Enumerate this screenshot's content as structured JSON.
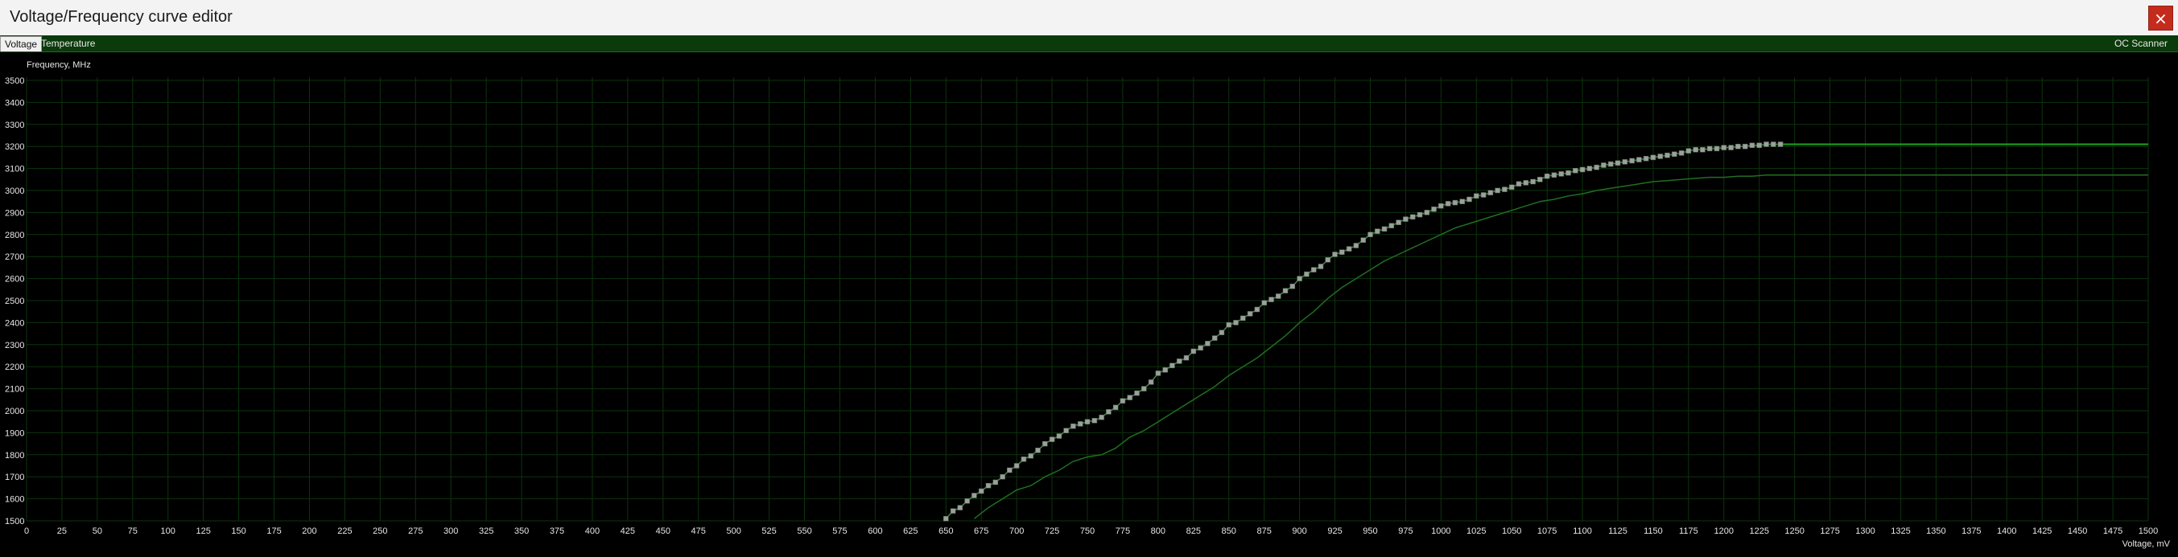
{
  "window": {
    "title": "Voltage/Frequency curve editor",
    "close_symbol": "×"
  },
  "tabs": {
    "voltage": "Voltage",
    "temperature": "Temperature",
    "oc_scanner": "OC Scanner"
  },
  "colors": {
    "grid": "#0c340c",
    "axis_text": "#e6e6e6",
    "curve": "#3c8f3c",
    "point": "#9aa09a",
    "baseline": "#1f6f1f",
    "flat_line": "#1aa31a"
  },
  "chart_data": {
    "type": "line",
    "ylabel": "Frequency, MHz",
    "xlabel": "Voltage, mV",
    "xlim": [
      0,
      1500
    ],
    "ylim": [
      1500,
      3500
    ],
    "x_ticks": [
      0,
      25,
      50,
      75,
      100,
      125,
      150,
      175,
      200,
      225,
      250,
      275,
      300,
      325,
      350,
      375,
      400,
      425,
      450,
      475,
      500,
      525,
      550,
      575,
      600,
      625,
      650,
      675,
      700,
      725,
      750,
      775,
      800,
      825,
      850,
      875,
      900,
      925,
      950,
      975,
      1000,
      1025,
      1050,
      1075,
      1100,
      1125,
      1150,
      1175,
      1200,
      1225,
      1250,
      1275,
      1300,
      1325,
      1350,
      1375,
      1400,
      1425,
      1450,
      1475,
      1500
    ],
    "y_ticks": [
      1500,
      1600,
      1700,
      1800,
      1900,
      2000,
      2100,
      2200,
      2300,
      2400,
      2500,
      2600,
      2700,
      2800,
      2900,
      3000,
      3100,
      3200,
      3300,
      3400,
      3500
    ],
    "grid": true,
    "series": [
      {
        "values": [
          [
            650,
            1510
          ],
          [
            655,
            1545
          ],
          [
            660,
            1560
          ],
          [
            665,
            1590
          ],
          [
            670,
            1615
          ],
          [
            675,
            1635
          ],
          [
            680,
            1660
          ],
          [
            685,
            1675
          ],
          [
            690,
            1700
          ],
          [
            695,
            1730
          ],
          [
            700,
            1750
          ],
          [
            705,
            1780
          ],
          [
            710,
            1795
          ],
          [
            715,
            1820
          ],
          [
            720,
            1850
          ],
          [
            725,
            1870
          ],
          [
            730,
            1885
          ],
          [
            735,
            1910
          ],
          [
            740,
            1930
          ],
          [
            745,
            1940
          ],
          [
            750,
            1950
          ],
          [
            755,
            1955
          ],
          [
            760,
            1970
          ],
          [
            765,
            1995
          ],
          [
            770,
            2015
          ],
          [
            775,
            2045
          ],
          [
            780,
            2060
          ],
          [
            785,
            2080
          ],
          [
            790,
            2100
          ],
          [
            795,
            2130
          ],
          [
            800,
            2170
          ],
          [
            805,
            2185
          ],
          [
            810,
            2205
          ],
          [
            815,
            2225
          ],
          [
            820,
            2240
          ],
          [
            825,
            2270
          ],
          [
            830,
            2285
          ],
          [
            835,
            2305
          ],
          [
            840,
            2330
          ],
          [
            845,
            2355
          ],
          [
            850,
            2390
          ],
          [
            855,
            2400
          ],
          [
            860,
            2420
          ],
          [
            865,
            2440
          ],
          [
            870,
            2460
          ],
          [
            875,
            2490
          ],
          [
            880,
            2505
          ],
          [
            885,
            2520
          ],
          [
            890,
            2545
          ],
          [
            895,
            2565
          ],
          [
            900,
            2600
          ],
          [
            905,
            2620
          ],
          [
            910,
            2640
          ],
          [
            915,
            2655
          ],
          [
            920,
            2685
          ],
          [
            925,
            2710
          ],
          [
            930,
            2720
          ],
          [
            935,
            2735
          ],
          [
            940,
            2750
          ],
          [
            945,
            2775
          ],
          [
            950,
            2800
          ],
          [
            955,
            2815
          ],
          [
            960,
            2825
          ],
          [
            965,
            2840
          ],
          [
            970,
            2855
          ],
          [
            975,
            2870
          ],
          [
            980,
            2880
          ],
          [
            985,
            2890
          ],
          [
            990,
            2900
          ],
          [
            995,
            2915
          ],
          [
            1000,
            2930
          ],
          [
            1005,
            2940
          ],
          [
            1010,
            2945
          ],
          [
            1015,
            2950
          ],
          [
            1020,
            2960
          ],
          [
            1025,
            2975
          ],
          [
            1030,
            2980
          ],
          [
            1035,
            2990
          ],
          [
            1040,
            3000
          ],
          [
            1045,
            3005
          ],
          [
            1050,
            3015
          ],
          [
            1055,
            3030
          ],
          [
            1060,
            3035
          ],
          [
            1065,
            3040
          ],
          [
            1070,
            3050
          ],
          [
            1075,
            3065
          ],
          [
            1080,
            3070
          ],
          [
            1085,
            3075
          ],
          [
            1090,
            3080
          ],
          [
            1095,
            3090
          ],
          [
            1100,
            3095
          ],
          [
            1105,
            3100
          ],
          [
            1110,
            3105
          ],
          [
            1115,
            3115
          ],
          [
            1120,
            3120
          ],
          [
            1125,
            3125
          ],
          [
            1130,
            3130
          ],
          [
            1135,
            3135
          ],
          [
            1140,
            3140
          ],
          [
            1145,
            3145
          ],
          [
            1150,
            3150
          ],
          [
            1155,
            3155
          ],
          [
            1160,
            3160
          ],
          [
            1165,
            3165
          ],
          [
            1170,
            3170
          ],
          [
            1175,
            3180
          ],
          [
            1180,
            3185
          ],
          [
            1185,
            3185
          ],
          [
            1190,
            3190
          ],
          [
            1195,
            3190
          ],
          [
            1200,
            3195
          ],
          [
            1205,
            3195
          ],
          [
            1210,
            3200
          ],
          [
            1215,
            3200
          ],
          [
            1220,
            3205
          ],
          [
            1225,
            3205
          ],
          [
            1230,
            3210
          ],
          [
            1235,
            3210
          ],
          [
            1240,
            3210
          ]
        ]
      },
      {
        "values": [
          [
            670,
            1510
          ],
          [
            680,
            1560
          ],
          [
            690,
            1600
          ],
          [
            700,
            1640
          ],
          [
            710,
            1660
          ],
          [
            720,
            1700
          ],
          [
            730,
            1730
          ],
          [
            740,
            1770
          ],
          [
            750,
            1790
          ],
          [
            760,
            1800
          ],
          [
            770,
            1830
          ],
          [
            780,
            1880
          ],
          [
            790,
            1910
          ],
          [
            800,
            1950
          ],
          [
            810,
            1990
          ],
          [
            820,
            2030
          ],
          [
            830,
            2070
          ],
          [
            840,
            2110
          ],
          [
            850,
            2160
          ],
          [
            860,
            2200
          ],
          [
            870,
            2240
          ],
          [
            880,
            2290
          ],
          [
            890,
            2340
          ],
          [
            900,
            2400
          ],
          [
            910,
            2450
          ],
          [
            920,
            2510
          ],
          [
            930,
            2560
          ],
          [
            940,
            2600
          ],
          [
            950,
            2640
          ],
          [
            960,
            2680
          ],
          [
            970,
            2710
          ],
          [
            980,
            2740
          ],
          [
            990,
            2770
          ],
          [
            1000,
            2800
          ],
          [
            1010,
            2830
          ],
          [
            1020,
            2850
          ],
          [
            1030,
            2870
          ],
          [
            1040,
            2890
          ],
          [
            1050,
            2910
          ],
          [
            1060,
            2930
          ],
          [
            1070,
            2950
          ],
          [
            1080,
            2960
          ],
          [
            1090,
            2975
          ],
          [
            1100,
            2985
          ],
          [
            1110,
            3000
          ],
          [
            1120,
            3010
          ],
          [
            1130,
            3020
          ],
          [
            1140,
            3030
          ],
          [
            1150,
            3040
          ],
          [
            1160,
            3045
          ],
          [
            1170,
            3050
          ],
          [
            1180,
            3055
          ],
          [
            1190,
            3060
          ],
          [
            1200,
            3060
          ],
          [
            1210,
            3065
          ],
          [
            1220,
            3065
          ],
          [
            1230,
            3070
          ],
          [
            1240,
            3070
          ],
          [
            1250,
            3070
          ],
          [
            1500,
            3070
          ]
        ]
      }
    ]
  }
}
